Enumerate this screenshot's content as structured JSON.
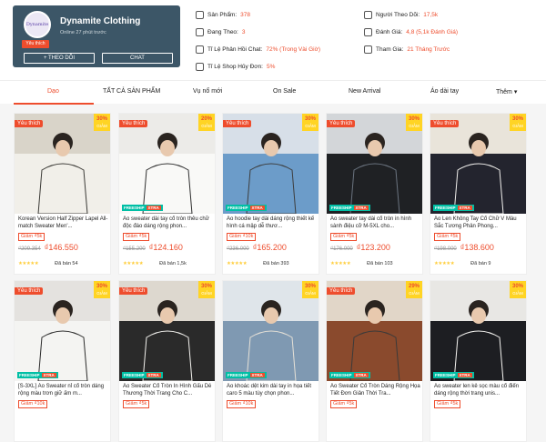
{
  "shop": {
    "name": "Dynamite Clothing",
    "online": "Online 27 phút trước",
    "favorite": "Yêu thích",
    "follow": "+ THEO DÕI",
    "chat": "CHAT",
    "logo_text": "Dynamite"
  },
  "stats": [
    {
      "label": "Sản Phẩm:",
      "value": "378",
      "icon": "store-icon"
    },
    {
      "label": "Đang Theo:",
      "value": "3",
      "icon": "user-plus-icon"
    },
    {
      "label": "Tỉ Lệ Phản Hồi Chat:",
      "value": "72% (Trong Vài Giờ)",
      "icon": "chat-icon"
    },
    {
      "label": "Tỉ Lệ Shop Hủy Đơn:",
      "value": "5%",
      "icon": "cancel-icon"
    },
    {
      "label": "Người Theo Dõi:",
      "value": "17,5k",
      "icon": "users-icon"
    },
    {
      "label": "Đánh Giá:",
      "value": "4,8 (5,1k Đánh Giá)",
      "icon": "star-icon"
    },
    {
      "label": "Tham Gia:",
      "value": "21 Tháng Trước",
      "icon": "calendar-icon"
    }
  ],
  "tabs": [
    "Dạo",
    "TẤT CẢ SẢN PHẨM",
    "Vụ nổ mới",
    "On Sale",
    "New Arrival",
    "Áo dài tay",
    "Thêm ▾"
  ],
  "products": [
    {
      "title": "Korean Version Half Zipper Lapel All-match Sweater Men'...",
      "discount": "30%",
      "off": "GIẢM",
      "orig": "₫209.354",
      "price": "₫146.550",
      "voucher": "Giảm ₫5k",
      "sold": "Đã bán 54",
      "favorite": true,
      "freeship": false,
      "palette": [
        "#d9d4c9",
        "#f1efe9",
        "#3b3a36"
      ]
    },
    {
      "title": "Áo sweater dài tay cổ tròn thêu chữ độc đáo dáng rộng phon...",
      "discount": "20%",
      "off": "GIẢM",
      "orig": "₫155.200",
      "price": "₫124.160",
      "voucher": "Giảm ₫5k",
      "sold": "Đã bán 1,5k",
      "favorite": true,
      "freeship": true,
      "palette": [
        "#ecebe8",
        "#f9f9f7",
        "#2e2e2e"
      ]
    },
    {
      "title": "Áo hoodie tay dài dáng rộng thiết kế hình cá mập dễ thươ...",
      "discount": "30%",
      "off": "GIẢM",
      "orig": "₫236.000",
      "price": "₫165.200",
      "voucher": "Giảm ₫10k",
      "sold": "Đã bán 393",
      "favorite": true,
      "freeship": true,
      "palette": [
        "#d7dfe8",
        "#6c9cc9",
        "#3d3d3d"
      ]
    },
    {
      "title": "Áo sweater tay dài cổ tròn in hình sành điệu cỡ M-5XL cho...",
      "discount": "30%",
      "off": "GIẢM",
      "orig": "₫176.000",
      "price": "₫123.200",
      "voucher": "Giảm ₫5k",
      "sold": "Đã bán 103",
      "favorite": true,
      "freeship": true,
      "palette": [
        "#d3d6d9",
        "#1f2124",
        "#6b7480"
      ]
    },
    {
      "title": "Áo Len Không Tay Cổ Chữ V Màu Sắc Tương Phản Phong...",
      "discount": "30%",
      "off": "GIẢM",
      "orig": "₫198.000",
      "price": "₫138.600",
      "voucher": "Giảm ₫5k",
      "sold": "Đã bán 9",
      "favorite": true,
      "freeship": true,
      "palette": [
        "#e9e4da",
        "#23242e",
        "#f2f1ee"
      ]
    },
    {
      "title": "[S-3XL] Áo Sweater nỉ cổ tròn dáng rộng màu trơn giữ ấm m...",
      "discount": "30%",
      "off": "GIẢM",
      "orig": "",
      "price": "",
      "voucher": "Giảm ₫10k",
      "sold": "",
      "favorite": true,
      "freeship": true,
      "palette": [
        "#e4e2df",
        "#f4f4f2",
        "#2b2b2b"
      ]
    },
    {
      "title": "Áo Sweater Cổ Tròn In Hình Gấu Dễ Thương Thời Trang Cho C...",
      "discount": "30%",
      "off": "GIẢM",
      "orig": "",
      "price": "",
      "voucher": "Giảm ₫5k",
      "sold": "",
      "favorite": true,
      "freeship": true,
      "palette": [
        "#ddd8cf",
        "#2a2a2a",
        "#f4f3ef"
      ]
    },
    {
      "title": "Áo khoác dệt kim dài tay in họa tiết caro 5 màu tùy chọn phon...",
      "discount": "30%",
      "off": "GIẢM",
      "orig": "",
      "price": "",
      "voucher": "Giảm ₫10k",
      "sold": "",
      "favorite": false,
      "freeship": true,
      "palette": [
        "#dfe5ea",
        "#7f99b2",
        "#e6e1d7"
      ]
    },
    {
      "title": "Áo Sweater Cổ Tròn Dáng Rộng Họa Tiết Đơn Giản Thời Tra...",
      "discount": "29%",
      "off": "GIẢM",
      "orig": "",
      "price": "",
      "voucher": "Giảm ₫5k",
      "sold": "",
      "favorite": true,
      "freeship": true,
      "palette": [
        "#e1d6c8",
        "#8a4a2d",
        "#3a3a3a"
      ]
    },
    {
      "title": "Áo sweater len kẻ sọc màu cổ điển dáng rộng thời trang unis...",
      "discount": "30%",
      "off": "GIẢM",
      "orig": "",
      "price": "",
      "voucher": "Giảm ₫5k",
      "sold": "",
      "favorite": false,
      "freeship": true,
      "palette": [
        "#e8e7e4",
        "#1d1e22",
        "#f7f6f3"
      ]
    }
  ],
  "labels": {
    "freeship": "FREESHIP",
    "xtra": "XTRA",
    "stars": "★★★★★"
  },
  "colors": {
    "accent": "#ee4d2d",
    "header": "#3c5667",
    "badge": "#ffd424"
  }
}
